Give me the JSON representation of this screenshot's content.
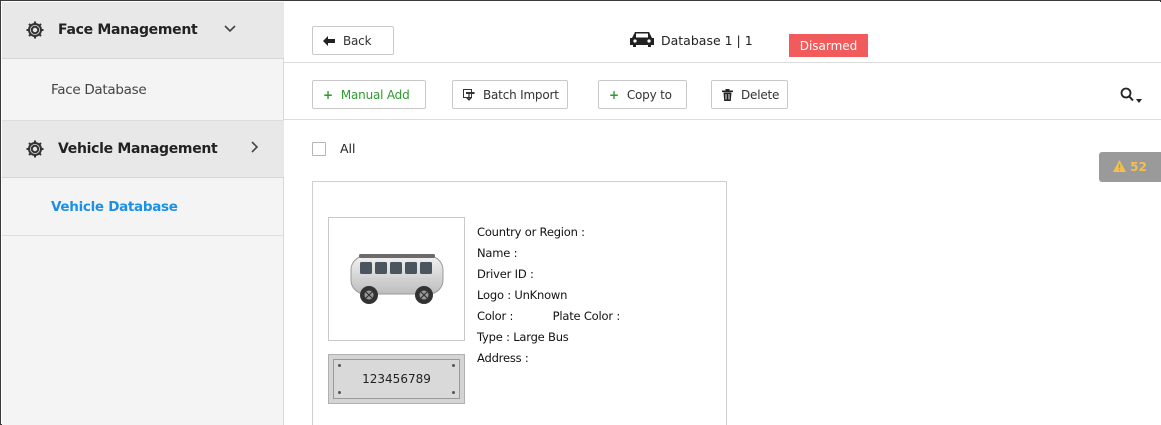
{
  "sidebar": {
    "groups": [
      {
        "label": "Face Management",
        "chevron": "chevron-down-icon",
        "items": [
          "Face Database"
        ]
      },
      {
        "label": "Vehicle Management",
        "chevron": "chevron-right-icon",
        "items": [
          "Vehicle Database"
        ]
      }
    ],
    "active_item": "Vehicle Database"
  },
  "header": {
    "back_label": "Back",
    "database_name": "Database 1 | 1",
    "status": "Disarmed"
  },
  "toolbar": {
    "manual_add": "Manual Add",
    "batch_import": "Batch Import",
    "copy_to": "Copy to",
    "delete": "Delete"
  },
  "content": {
    "select_all_label": "All",
    "alarm_count": "52",
    "vehicle": {
      "plate_number": "123456789",
      "fields": {
        "country_region": "Country or Region :",
        "name": "Name :",
        "driver_id": "Driver ID :",
        "logo": "Logo : UnKnown",
        "color": "Color :",
        "plate_color": "Plate Color :",
        "type": "Type : Large Bus",
        "address": "Address :"
      }
    }
  },
  "colors": {
    "accent": "#1a91e6",
    "status_disarmed": "#f25b5b",
    "add_green": "#2f9a2f",
    "alarm_badge": "#9a9a9a",
    "alarm_icon": "#f5c04a"
  }
}
